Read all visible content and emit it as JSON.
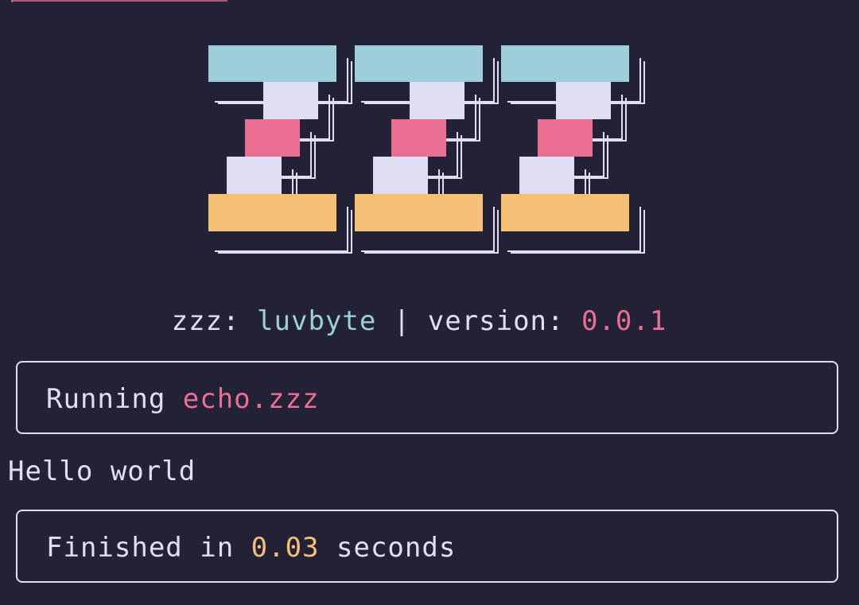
{
  "colors": {
    "background": "#232136",
    "text": "#e0def4",
    "cyan": "#9ccfd8",
    "pink": "#eb6f92",
    "gold": "#f6c177"
  },
  "logo": {
    "name": "zzz-ascii-logo",
    "letters": [
      "z",
      "z",
      "z"
    ]
  },
  "header": {
    "prefix": "zzz: ",
    "author": "luvbyte",
    "separator": " | version: ",
    "version": "0.0.1"
  },
  "running": {
    "label": "Running ",
    "file": "echo.zzz"
  },
  "output": {
    "line": "Hello world"
  },
  "finished": {
    "prefix": "Finished in ",
    "time": "0.03",
    "suffix": " seconds"
  }
}
